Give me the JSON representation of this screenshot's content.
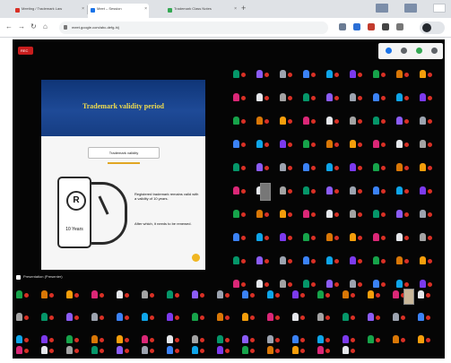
{
  "browser": {
    "tabs": [
      {
        "label": "Meeting / Trademark Law",
        "active": false,
        "favicon": "#d93025"
      },
      {
        "label": "Meet – Session",
        "active": true,
        "favicon": "#1a73e8"
      },
      {
        "label": "Trademark Class Notes",
        "active": false,
        "favicon": "#34a853"
      }
    ],
    "new_tab": "+",
    "url": "meet.google.com/abc-defg-hij",
    "nav": {
      "back": "←",
      "forward": "→",
      "reload": "↻",
      "home": "⌂"
    }
  },
  "meeting": {
    "rec_label": "REC",
    "presenter_label": "Presentation (Presenter)"
  },
  "slide": {
    "title": "Trademark validity period",
    "subtitle": "Trademark validity",
    "icon_letter": "R",
    "icon_years": "10 Years",
    "text1": "Registered trademark remains valid with a validity of 10 years.",
    "text2": "After which, it needs to be renewed."
  },
  "colors": {
    "brand_blue": "#1e4a97",
    "title_yellow": "#f0dc4e",
    "mic_red": "#d93025",
    "meeting_bg": "#050505"
  }
}
